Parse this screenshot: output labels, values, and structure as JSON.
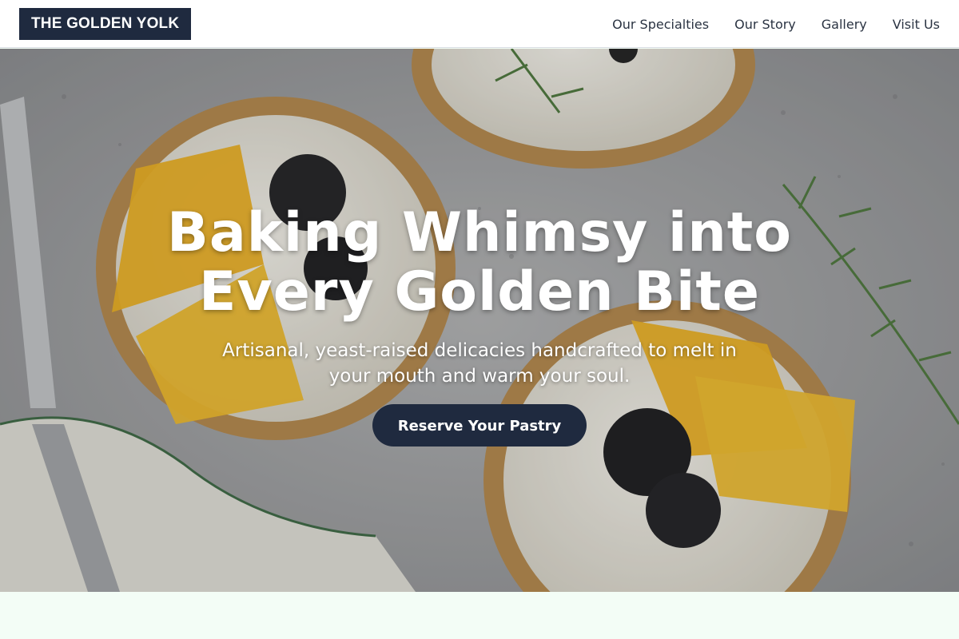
{
  "brand": {
    "name": "THE GOLDEN YOLK"
  },
  "nav": {
    "items": [
      {
        "label": "Our Specialties"
      },
      {
        "label": "Our Story"
      },
      {
        "label": "Gallery"
      },
      {
        "label": "Visit Us"
      }
    ]
  },
  "hero": {
    "headline_line1": "Baking Whimsy into",
    "headline_line2": "Every Golden Bite",
    "subtitle_line1": "Artisanal, yeast-raised delicacies handcrafted to melt in",
    "subtitle_line2": "your mouth and warm your soul.",
    "cta_label": "Reserve Your Pastry"
  },
  "colors": {
    "navy": "#1f2a3f",
    "header_bg": "#ffffff",
    "section_bg": "#f3fdf6",
    "orange": "#f2b421"
  }
}
